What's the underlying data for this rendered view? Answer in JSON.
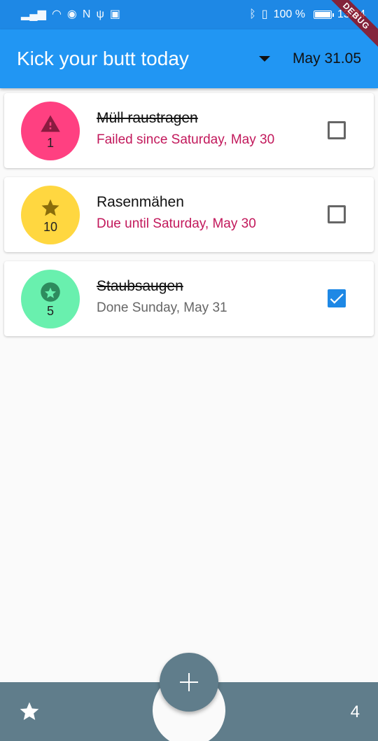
{
  "status_bar": {
    "battery": "100 %",
    "time": "13:34"
  },
  "debug_label": "DEBUG",
  "app_bar": {
    "title": "Kick your butt today",
    "date_select": "May 31.05"
  },
  "tasks": [
    {
      "name": "Müll raustragen",
      "status": "Failed since Saturday, May 30",
      "count": "1",
      "icon": "warning-icon",
      "avatar_color": "#ff4081",
      "checked": false,
      "struck": true
    },
    {
      "name": "Rasenmähen",
      "status": "Due until Saturday, May 30",
      "count": "10",
      "icon": "star-icon",
      "avatar_color": "#ffd740",
      "checked": false,
      "struck": false
    },
    {
      "name": "Staubsaugen",
      "status": "Done Sunday, May 31",
      "count": "5",
      "icon": "star-circle-icon",
      "avatar_color": "#69f0ae",
      "checked": true,
      "struck": true
    }
  ],
  "bottom_bar": {
    "count": "4"
  },
  "colors": {
    "app_bar": "#2196f3",
    "bottom_bar": "#607d8b",
    "overdue_text": "#c2185b",
    "checkbox_checked": "#1e88e5"
  }
}
